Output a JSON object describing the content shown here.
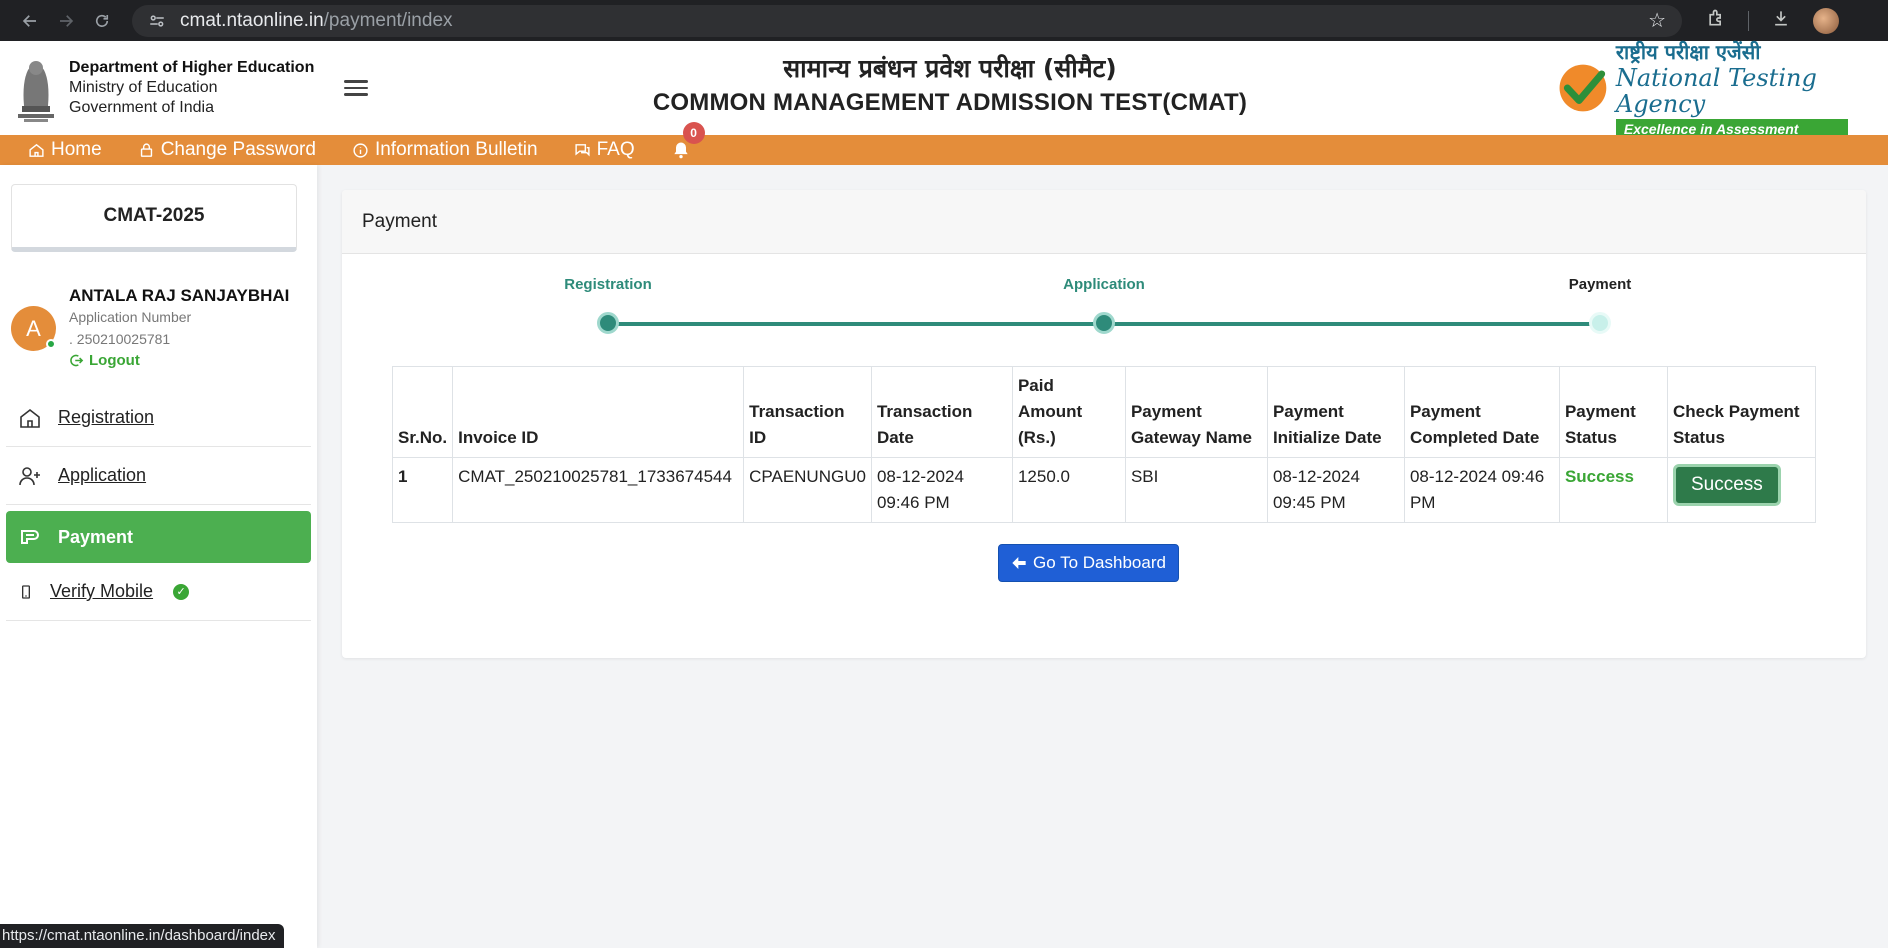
{
  "browser": {
    "url_host": "cmat.ntaonline.in",
    "url_path": "/payment/index",
    "status_url": "https://cmat.ntaonline.in/dashboard/index"
  },
  "header": {
    "dept_line1": "Department of Higher Education",
    "dept_line2": "Ministry of Education",
    "dept_line3": "Government of India",
    "title_hindi": "सामान्य प्रबंधन प्रवेश परीक्षा (सीमैट)",
    "title_english": "COMMON MANAGEMENT ADMISSION TEST(CMAT)",
    "nta_hindi": "राष्ट्रीय परीक्षा एजेंसी",
    "nta_english": "National Testing Agency",
    "nta_tagline": "Excellence in Assessment"
  },
  "topnav": {
    "home": "Home",
    "change_password": "Change Password",
    "information_bulletin": "Information Bulletin",
    "faq": "FAQ",
    "notification_count": "0"
  },
  "sidebar": {
    "exam_name": "CMAT-2025",
    "avatar_initial": "A",
    "user_name": "ANTALA RAJ SANJAYBHAI",
    "app_number_label": "Application Number",
    "app_number": ". 250210025781",
    "logout": "Logout",
    "items": [
      {
        "label": "Registration"
      },
      {
        "label": "Application"
      },
      {
        "label": "Payment"
      },
      {
        "label": "Verify Mobile"
      }
    ]
  },
  "main": {
    "card_title": "Payment",
    "steps": [
      {
        "label": "Registration",
        "state": "done"
      },
      {
        "label": "Application",
        "state": "done"
      },
      {
        "label": "Payment",
        "state": "current"
      }
    ],
    "table": {
      "headers": [
        "Sr.No.",
        "Invoice ID",
        "Transaction ID",
        "Transaction Date",
        "Paid Amount (Rs.)",
        "Payment Gateway Name",
        "Payment Initialize Date",
        "Payment Completed Date",
        "Payment Status",
        "Check Payment Status"
      ],
      "rows": [
        {
          "sr": "1",
          "invoice": "CMAT_250210025781_1733674544",
          "txn_id": "CPAENUNGU0",
          "txn_date": "08-12-2024 09:46 PM",
          "amount": "1250.0",
          "gateway": "SBI",
          "init_date": "08-12-2024 09:45 PM",
          "completed_date": "08-12-2024 09:46 PM",
          "status": "Success",
          "check_button": "Success"
        }
      ]
    },
    "dashboard_button": "Go To Dashboard"
  },
  "colors": {
    "nav_orange": "#e48d3a",
    "active_green": "#4caf50",
    "stepper_teal": "#2e8b7a",
    "dashboard_blue": "#1f5fd6"
  }
}
